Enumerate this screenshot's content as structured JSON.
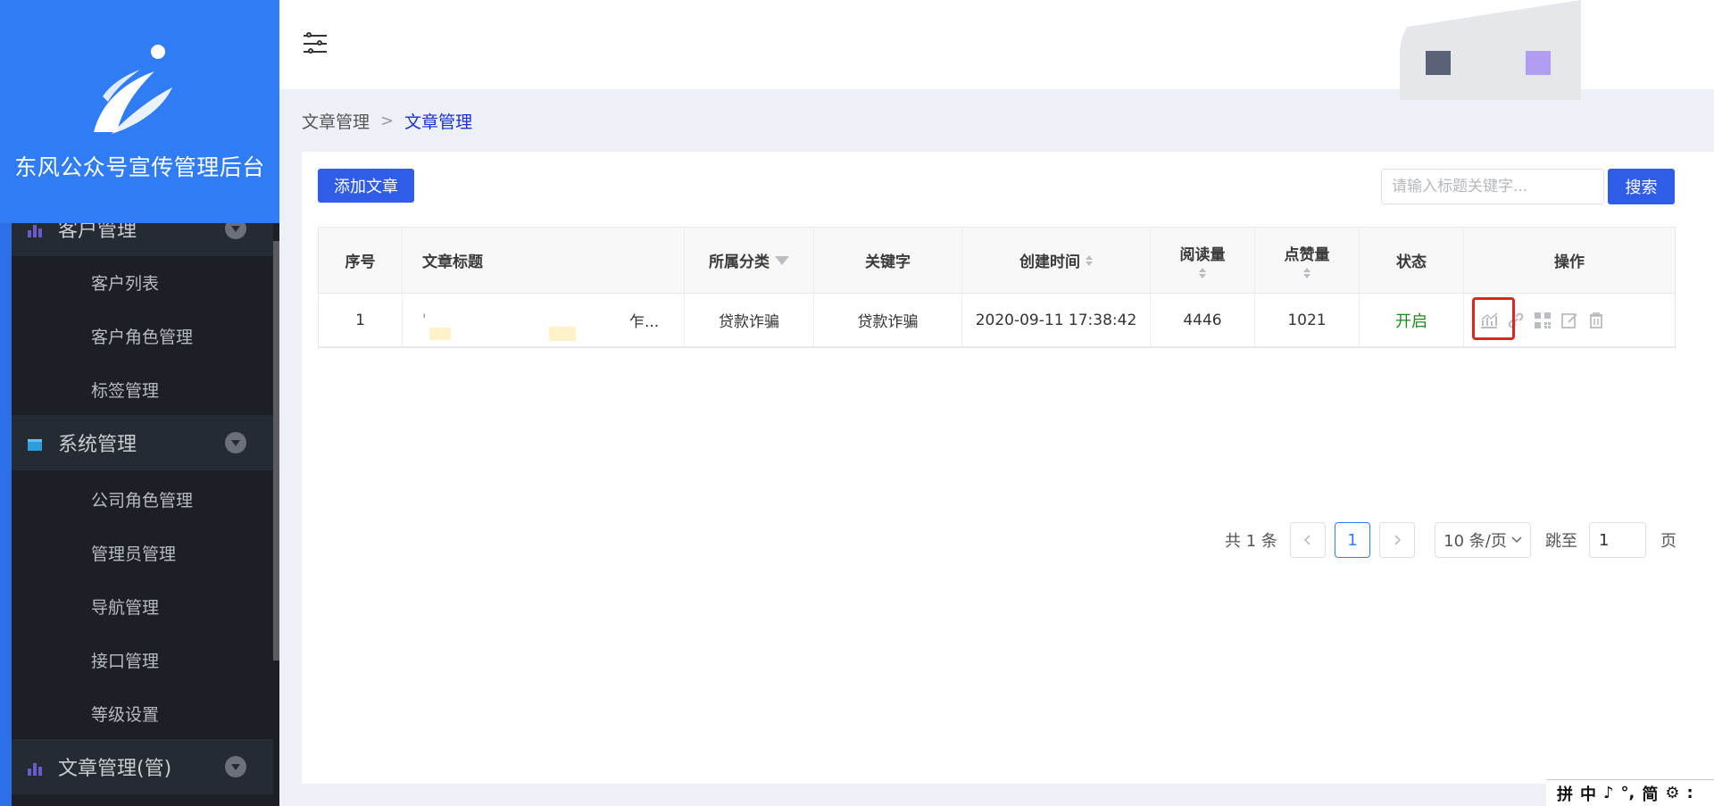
{
  "app": {
    "title": "东风公众号宣传管理后台"
  },
  "sidebar": {
    "groups": [
      {
        "label": "客户管理",
        "icon": "bar-chart-icon"
      },
      {
        "label": "系统管理",
        "icon": "calendar-icon"
      },
      {
        "label": "文章管理(管)",
        "icon": "bar-chart-icon"
      }
    ],
    "customer_items": [
      "客户列表",
      "客户角色管理",
      "标签管理"
    ],
    "system_items": [
      "公司角色管理",
      "管理员管理",
      "导航管理",
      "接口管理",
      "等级设置"
    ]
  },
  "breadcrumb": {
    "parent": "文章管理",
    "separator": ">",
    "current": "文章管理"
  },
  "toolbar": {
    "add_label": "添加文章",
    "search_placeholder": "请输入标题关键字...",
    "search_label": "搜索"
  },
  "table": {
    "headers": {
      "index": "序号",
      "title": "文章标题",
      "category": "所属分类",
      "keyword": "关键字",
      "created": "创建时间",
      "reads": "阅读量",
      "likes": "点赞量",
      "status": "状态",
      "ops": "操作"
    },
    "rows": [
      {
        "index": "1",
        "title_start": "'",
        "title_end": "乍...",
        "category": "贷款诈骗",
        "keyword": "贷款诈骗",
        "created": "2020-09-11 17:38:42",
        "reads": "4446",
        "likes": "1021",
        "status": "开启"
      }
    ]
  },
  "pagination": {
    "total": "共 1 条",
    "current_page": "1",
    "page_size": "10 条/页",
    "jump_label": "跳至",
    "jump_value": "1",
    "page_unit": "页"
  },
  "ime": {
    "items": [
      "拼",
      "中",
      "♪",
      "°,",
      "简",
      "⚙",
      ":"
    ]
  },
  "colors": {
    "logo_bg": "#2f7cf5",
    "sidebar_bg": "#1c1f26",
    "primary": "#2f5de8",
    "status_on": "#1d8a1d",
    "swatch_1": "#596277",
    "swatch_2": "#b19ef3"
  }
}
